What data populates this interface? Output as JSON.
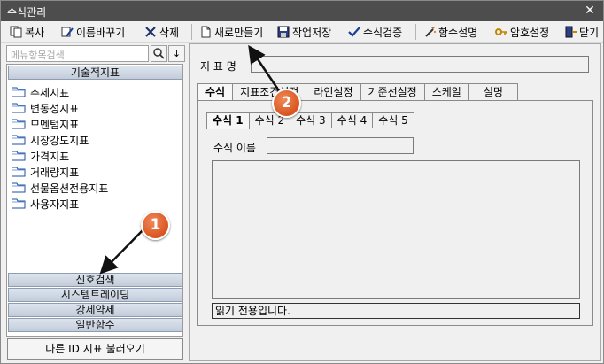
{
  "window": {
    "title": "수식관리",
    "close_glyph": "✕"
  },
  "toolbar": {
    "copy": "복사",
    "rename": "이름바꾸기",
    "delete": "삭제",
    "new": "새로만들기",
    "save": "작업저장",
    "verify": "수식검증",
    "func_help": "함수설명",
    "password": "암호설정",
    "close": "닫기"
  },
  "search": {
    "placeholder": "메뉴항목검색",
    "search_glyph": "🔍",
    "down_glyph": "↓"
  },
  "left": {
    "category_head": "기술적지표",
    "tree_items": [
      "추세지표",
      "변동성지표",
      "모멘텀지표",
      "시장강도지표",
      "가격지표",
      "거래량지표",
      "선물옵션전용지표",
      "사용자지표"
    ],
    "categories": [
      "신호검색",
      "시스템트레이딩",
      "강세약세",
      "일반함수"
    ],
    "load_button": "다른 ID 지표 불러오기"
  },
  "right": {
    "indicator_name_label": "지 표 명",
    "tabs": [
      "수식",
      "지표조건설정",
      "라인설정",
      "기준선설정",
      "스케일",
      "설명"
    ],
    "subtabs": [
      "수식 1",
      "수식 2",
      "수식 3",
      "수식 4",
      "수식 5"
    ],
    "formula_name_label": "수식 이름",
    "status_text": "읽기 전용입니다."
  },
  "markers": {
    "m1": "1",
    "m2": "2"
  },
  "colors": {
    "titlebar": "#4d4d4d",
    "marker": "#d9541f",
    "category_bar": "#c2ccd9"
  }
}
